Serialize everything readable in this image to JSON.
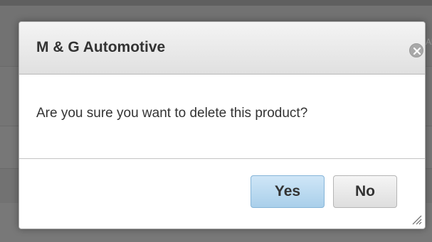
{
  "background": {
    "partial_text": "Al"
  },
  "dialog": {
    "title": "M & G Automotive",
    "close_icon": "close-circle-icon",
    "message": "Are you sure you want to delete this product?",
    "buttons": {
      "yes_label": "Yes",
      "no_label": "No"
    },
    "resize_icon": "resize-grip-icon"
  },
  "colors": {
    "overlay": "#717171",
    "header_bg": "#e8e8e8",
    "primary_button": "#b9d9f0",
    "secondary_button": "#e9e9e9",
    "text": "#333333"
  }
}
